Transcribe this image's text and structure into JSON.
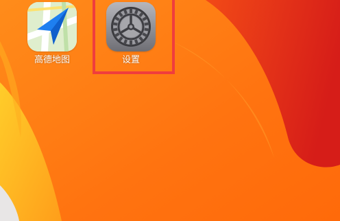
{
  "screen": "home-screen",
  "apps": [
    {
      "id": "maps",
      "label": "高德地图",
      "icon": "navigation-arrow-icon"
    },
    {
      "id": "settings",
      "label": "设置",
      "icon": "gear-icon"
    }
  ],
  "highlight": {
    "target": "settings",
    "color": "#f03d3d"
  },
  "colors": {
    "wallpaper_orange": "#ff7a10",
    "wallpaper_yellow": "#ffc21e",
    "wallpaper_red": "#e8271a",
    "maps_arrow": "#1e7ff0",
    "settings_gray": "#8e8e93"
  }
}
